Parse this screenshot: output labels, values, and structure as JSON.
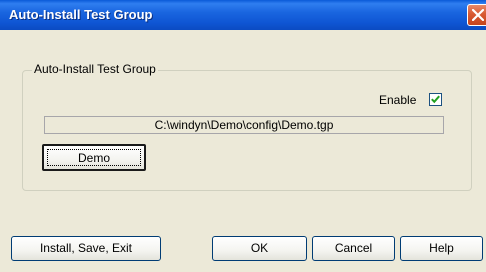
{
  "window": {
    "title": "Auto-Install Test Group",
    "close_icon": "close-icon"
  },
  "group": {
    "legend": "Auto-Install Test Group",
    "enable_label": "Enable",
    "enable_checked": true,
    "path": "C:\\windyn\\Demo\\config\\Demo.tgp",
    "demo_button": "Demo"
  },
  "buttons": {
    "install_save_exit": "Install, Save, Exit",
    "ok": "OK",
    "cancel": "Cancel",
    "help": "Help"
  },
  "colors": {
    "titlebar": "#0b4bc2",
    "close_button": "#d85a33",
    "dialog_background": "#ece9d8"
  }
}
